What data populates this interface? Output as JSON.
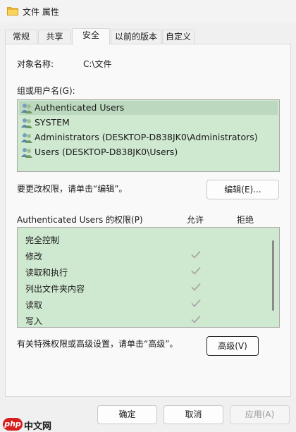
{
  "window": {
    "title": "文件 属性",
    "icon": "folder-icon"
  },
  "tabs": [
    {
      "label": "常规"
    },
    {
      "label": "共享"
    },
    {
      "label": "安全",
      "active": true
    },
    {
      "label": "以前的版本"
    },
    {
      "label": "自定义"
    }
  ],
  "security": {
    "object_label": "对象名称:",
    "object_value": "C:\\文件",
    "group_label": "组或用户名(G):",
    "users": [
      {
        "name": "Authenticated Users",
        "icon": "user-group-icon",
        "selected": true
      },
      {
        "name": "SYSTEM",
        "icon": "user-group-icon"
      },
      {
        "name": "Administrators (DESKTOP-D838JK0\\Administrators)",
        "icon": "user-group-icon"
      },
      {
        "name": "Users (DESKTOP-D838JK0\\Users)",
        "icon": "user-group-icon"
      }
    ],
    "change_hint": "要更改权限，请单击“编辑”。",
    "edit_button": "编辑(E)...",
    "perm_label": "Authenticated Users 的权限(P)",
    "allow_header": "允许",
    "deny_header": "拒绝",
    "permissions": [
      {
        "name": "完全控制",
        "allow": false,
        "deny": false
      },
      {
        "name": "修改",
        "allow": true,
        "deny": false
      },
      {
        "name": "读取和执行",
        "allow": true,
        "deny": false
      },
      {
        "name": "列出文件夹内容",
        "allow": true,
        "deny": false
      },
      {
        "name": "读取",
        "allow": true,
        "deny": false
      },
      {
        "name": "写入",
        "allow": true,
        "deny": false
      }
    ],
    "advanced_hint": "有关特殊权限或高级设置，请单击“高级”。",
    "advanced_button": "高级(V)"
  },
  "buttons": {
    "ok": "确定",
    "cancel": "取消",
    "apply": "应用(A)"
  },
  "colors": {
    "list_bg": "#cfe8d0",
    "selected_bg": "#bcd9bf",
    "check": "#a9a9a9",
    "watermark_red": "#d6201f"
  },
  "watermark": {
    "logo_text": "php",
    "site_text": "中文网"
  }
}
